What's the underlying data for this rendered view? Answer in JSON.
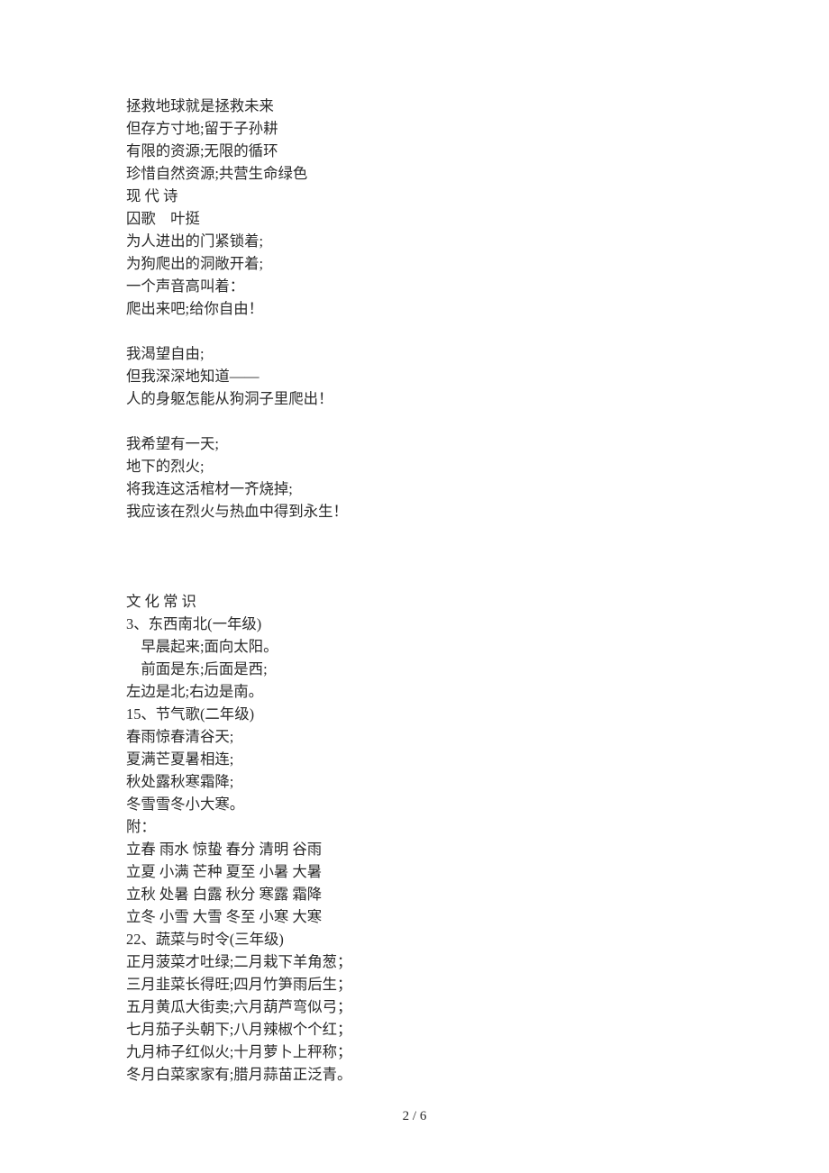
{
  "slogans": [
    "拯救地球就是拯救未来",
    "但存方寸地;留于子孙耕",
    "有限的资源;无限的循环",
    "珍惜自然资源;共营生命绿色"
  ],
  "modern_poetry_heading": "现 代 诗",
  "poem_title": "囚歌　叶挺",
  "poem": {
    "stanza1": [
      "为人进出的门紧锁着;",
      "为狗爬出的洞敞开着;",
      "一个声音高叫着：",
      "爬出来吧;给你自由！"
    ],
    "stanza2": [
      "我渴望自由;",
      "但我深深地知道——",
      "人的身躯怎能从狗洞子里爬出！"
    ],
    "stanza3": [
      "我希望有一天;",
      "地下的烈火;",
      "将我连这活棺材一齐烧掉;",
      "我应该在烈火与热血中得到永生！"
    ]
  },
  "culture_heading": "文 化 常 识",
  "section3": {
    "title": "3、东西南北(一年级)",
    "lines_indented": [
      "早晨起来;面向太阳。",
      "前面是东;后面是西;"
    ],
    "lines": [
      "左边是北;右边是南。"
    ]
  },
  "section15": {
    "title": "15、节气歌(二年级)",
    "lines": [
      "春雨惊春清谷天;",
      "夏满芒夏暑相连;",
      "秋处露秋寒霜降;",
      "冬雪雪冬小大寒。"
    ],
    "appendix_label": "附：",
    "appendix": [
      "立春 雨水 惊蛰 春分 清明 谷雨",
      "立夏 小满 芒种 夏至 小暑 大暑",
      "立秋 处暑 白露 秋分 寒露 霜降",
      "立冬 小雪 大雪 冬至 小寒 大寒"
    ]
  },
  "section22": {
    "title": "22、蔬菜与时令(三年级)",
    "lines": [
      "正月菠菜才吐绿;二月栽下羊角葱；",
      "三月韭菜长得旺;四月竹笋雨后生；",
      "五月黄瓜大街卖;六月葫芦弯似弓；",
      "七月茄子头朝下;八月辣椒个个红；",
      "九月柿子红似火;十月萝卜上秤称；",
      "冬月白菜家家有;腊月蒜苗正泛青。"
    ]
  },
  "footer": "2 / 6"
}
